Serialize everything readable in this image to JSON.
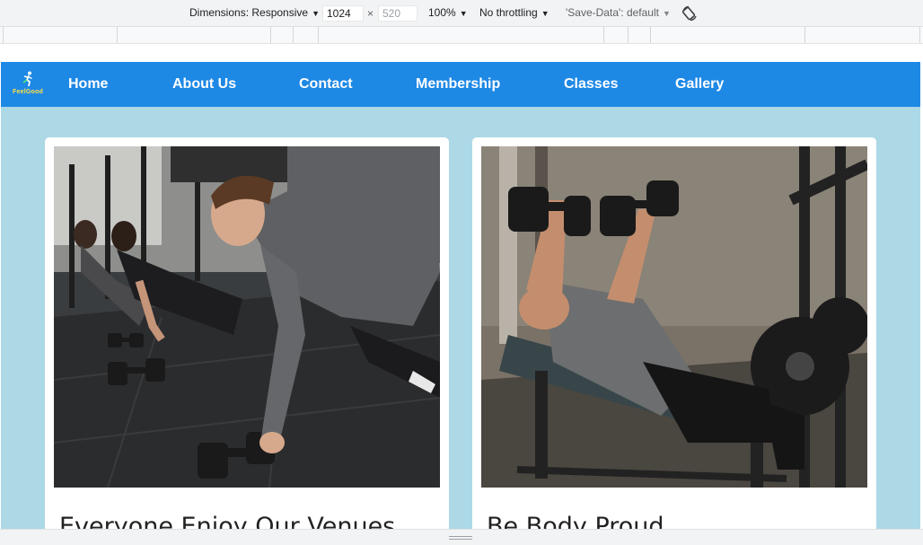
{
  "devtools": {
    "dimensions_label": "Dimensions: Responsive",
    "width_value": "1024",
    "times_sign": "×",
    "height_value": "520",
    "zoom": "100%",
    "throttling": "No throttling",
    "save_data": "'Save-Data': default",
    "icons": {
      "caret": "caret-down-icon",
      "rotate": "rotate-icon"
    }
  },
  "site": {
    "logo_text": "FeelGood",
    "nav": [
      "Home",
      "About Us",
      "Contact",
      "Membership",
      "Classes",
      "Gallery"
    ],
    "colors": {
      "nav_bg": "#1e88e5",
      "page_bg": "#add8e6",
      "logo_text": "#fde047"
    }
  },
  "cards": [
    {
      "title": "Everyone Enjoy Our Venues",
      "image": "group-dumbbell-rows-photo"
    },
    {
      "title": "Be Body Proud",
      "image": "bench-dumbbell-press-photo"
    }
  ]
}
